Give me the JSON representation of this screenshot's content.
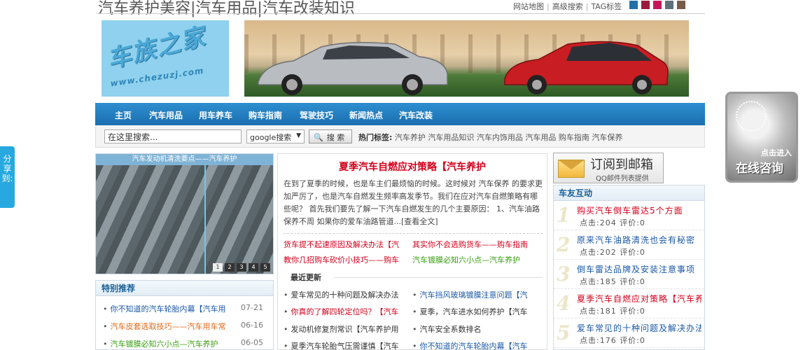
{
  "header": {
    "site_title": "汽车养护美容|汽车用品|汽车改装知识",
    "links": [
      "网站地图",
      "高级搜索",
      "TAG标签"
    ],
    "swatch_colors": [
      "#1f6fa8",
      "#9b1b3a",
      "#c2185b",
      "#5f6f7a",
      "#7a5a48"
    ]
  },
  "logo": {
    "text": "车族之家",
    "url_text": "www.chezuzj.com"
  },
  "nav": {
    "items": [
      "主页",
      "汽车用品",
      "用车养车",
      "购车指南",
      "驾驶技巧",
      "新闻热点",
      "汽车改装"
    ]
  },
  "search": {
    "placeholder": "在这里搜索...",
    "engine": "google搜索",
    "button": "搜 索",
    "hot_label": "热门标签:",
    "hot_tags": [
      "汽车养护",
      "汽车用品知识",
      "汽车内饰用品",
      "汽车用品",
      "购车指南",
      "汽车保养"
    ]
  },
  "slideshow": {
    "caption": "汽车发动机清洗要点——汽车养护",
    "dots": [
      "1",
      "2",
      "3",
      "4",
      "5"
    ]
  },
  "featured": {
    "heading": "特别推荐",
    "items": [
      {
        "title": "你不知道的汽车轮胎内幕【汽车用",
        "date": "07-21",
        "color": "#1a58a8"
      },
      {
        "title": "汽车皮套选取技巧——汽车用车常",
        "date": "06-16",
        "color": "#e06a1a"
      },
      {
        "title": "汽车镀膜必知六小点—汽车养护",
        "date": "06-05",
        "color": "#3aa012"
      }
    ]
  },
  "article": {
    "title": "夏季汽车自燃应对策略【汽车养护",
    "body": "在到了夏季的时候，也是车主们最烦恼的时候。这时候对 汽车保养 的要求更加严厉了，也是汽车自燃发生频率高发季节。我们在应对汽车自燃策略有哪些呢？ 首先我们要先了解一下汽车自燃发生的几个主要原因： 1、汽车油路保养不周 如果你的爱车油路管道...[查看全文]",
    "quick_links": [
      {
        "text": "货车提不起速原因及解决办法【汽",
        "color": "#d3001a"
      },
      {
        "text": "其实你不会选购货车——购车指南",
        "color": "#d3001a"
      },
      {
        "text": "教你几招购车砍价小技巧——购车",
        "color": "#d3001a"
      },
      {
        "text": "汽车镀膜必知六小点—汽车养护",
        "color": "#3aa012"
      }
    ],
    "latest_heading": "最近更新",
    "latest": [
      {
        "text": "爱车常见的十种问题及解决办法",
        "color": "#333333"
      },
      {
        "text": "汽车挡风玻璃镀膜注意问题【汽",
        "color": "#1a58a8"
      },
      {
        "text": "你真的了解四轮定位吗？【汽车",
        "color": "#d3001a"
      },
      {
        "text": "夏季，汽车进水如何养护【汽车",
        "color": "#333333"
      },
      {
        "text": "发动机修复剂常识【汽车养护用",
        "color": "#333333"
      },
      {
        "text": "汽车安全系数排名",
        "color": "#333333"
      },
      {
        "text": "夏季汽车轮胎气压需谨慎【汽车",
        "color": "#333333"
      },
      {
        "text": "你不知道的汽车轮胎内幕【汽车",
        "color": "#1a58a8"
      }
    ]
  },
  "subscribe": {
    "title": "订阅到邮箱",
    "subtitle": "QQ邮件列表提供"
  },
  "interact": {
    "heading": "车友互动",
    "items": [
      {
        "num": "1",
        "title": "购买汽车倒车雷达5个方面",
        "meta": "点击:204  评价:0",
        "color": "#d3001a"
      },
      {
        "num": "2",
        "title": "原来汽车油路清洗也会有秘密",
        "meta": "点击:202  评价:0",
        "color": "#1a58a8"
      },
      {
        "num": "3",
        "title": "倒车雷达品牌及安装注意事项",
        "meta": "点击:185  评价:0",
        "color": "#1a58a8"
      },
      {
        "num": "4",
        "title": "夏季汽车自燃应对策略【汽车养护",
        "meta": "点击:181  评价:0",
        "color": "#d3001a"
      },
      {
        "num": "5",
        "title": "爱车常见的十种问题及解决办法",
        "meta": "点击:176  评价:0",
        "color": "#1a58a8"
      }
    ]
  },
  "share": {
    "label": "分享到:"
  },
  "consult": {
    "small": "点击进入",
    "big": "在线咨询"
  }
}
